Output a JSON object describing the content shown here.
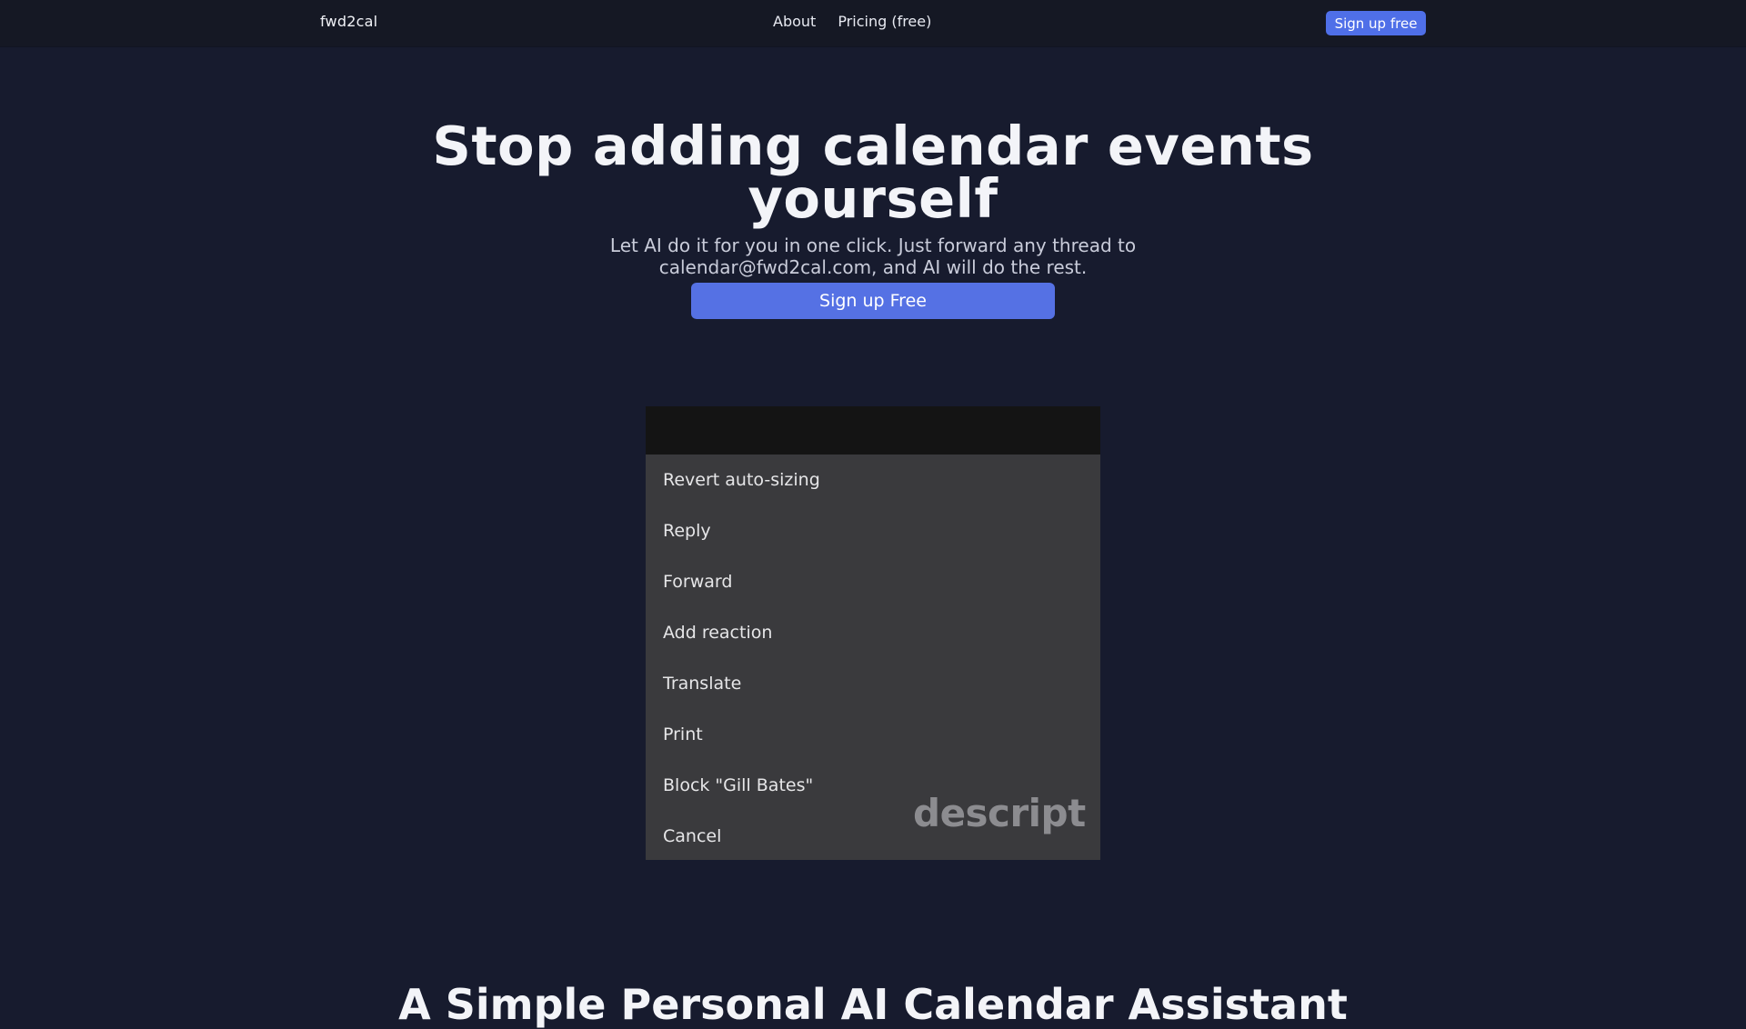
{
  "nav": {
    "brand": "fwd2cal",
    "links": [
      {
        "label": "About"
      },
      {
        "label": "Pricing (free)"
      }
    ],
    "cta_label": "Sign up free"
  },
  "hero": {
    "title": "Stop adding calendar events yourself",
    "subtitle": "Let AI do it for you in one click. Just forward any thread to calendar@fwd2cal.com, and AI will do the rest.",
    "cta_label": "Sign up Free"
  },
  "demo": {
    "menu_items": [
      {
        "label": "Revert auto-sizing"
      },
      {
        "label": "Reply"
      },
      {
        "label": "Forward"
      },
      {
        "label": "Add reaction"
      },
      {
        "label": "Translate"
      },
      {
        "label": "Print"
      },
      {
        "label": "Block \"Gill Bates\""
      },
      {
        "label": "Cancel"
      }
    ],
    "watermark": "descript"
  },
  "section": {
    "title": "A Simple Personal AI Calendar Assistant"
  },
  "colors": {
    "page_bg": "#171b2e",
    "topbar_bg": "#151824",
    "accent": "#5571e4",
    "menu_bg": "#3a3a3d"
  }
}
